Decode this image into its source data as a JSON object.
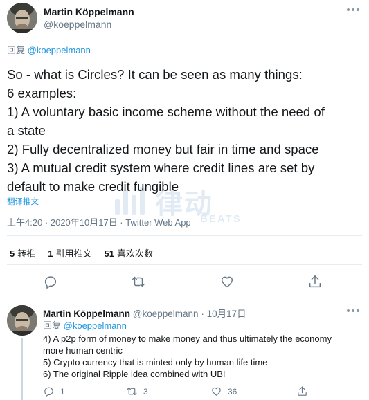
{
  "main_tweet": {
    "author_name": "Martin Köppelmann",
    "author_handle": "@koeppelmann",
    "reply_prefix": "回复",
    "reply_mention": "@koeppelmann",
    "text_lines": [
      "So - what is Circles? It can be seen as many things:",
      "6 examples:",
      "1) A voluntary basic income scheme without the need of",
      "a state",
      "2) Fully decentralized money but fair in time and space",
      "3) A mutual credit system where credit lines are set by",
      "default to make credit fungible"
    ],
    "translate_label": "翻译推文",
    "timestamp": "上午4:20 · 2020年10月17日 · Twitter Web App",
    "stats": {
      "retweets_count": "5",
      "retweets_label": "转推",
      "quotes_count": "1",
      "quotes_label": "引用推文",
      "likes_count": "51",
      "likes_label": "喜欢次数"
    }
  },
  "watermark": {
    "cn_text": "律动",
    "en_text": "BEATS"
  },
  "reply_tweet": {
    "author_name": "Martin Köppelmann",
    "author_handle": "@koeppelmann",
    "date": "10月17日",
    "reply_prefix": "回复",
    "reply_mention": "@koeppelmann",
    "text_lines": [
      "4) A p2p form of money to make money and thus ultimately the economy",
      "more human centric",
      "5) Crypto currency that is minted only by human life time",
      "6) The original Ripple idea combined with UBI"
    ],
    "reply_count": "1",
    "retweet_count": "3",
    "like_count": "36"
  },
  "colors": {
    "link": "#1b95e0",
    "secondary_text": "#657786",
    "primary_text": "#14171a",
    "divider": "#e6ecf0"
  }
}
